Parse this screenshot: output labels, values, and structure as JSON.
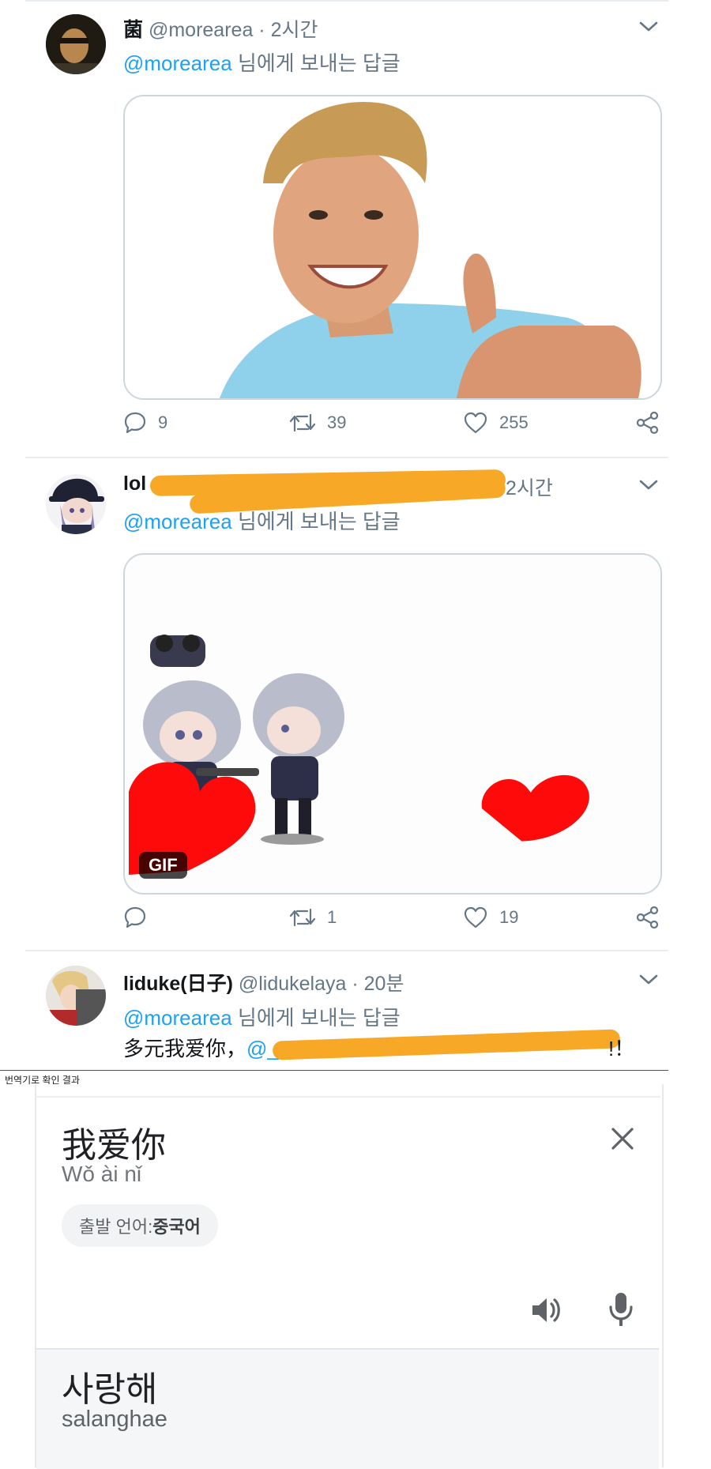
{
  "tweets": [
    {
      "name": "菌",
      "handle": "@morearea",
      "dot": "·",
      "time": "2시간",
      "reply_mention": "@morearea",
      "reply_suffix": " 님에게 보내는 답글",
      "replies": "9",
      "retweets": "39",
      "likes": "255"
    },
    {
      "name": "lol",
      "time": "2시간",
      "reply_mention": "@morearea",
      "reply_suffix": " 님에게 보내는 답글",
      "gif_label": "GIF",
      "replies": "",
      "retweets": "1",
      "likes": "19"
    },
    {
      "name": "liduke(日子)",
      "handle": "@lidukelaya",
      "dot": "·",
      "time": "20분",
      "reply_mention": "@morearea",
      "reply_suffix": " 님에게 보내는 답글",
      "body_start": "多元我爱你，",
      "body_mention": "@_Cl",
      "body_end": "!！"
    }
  ],
  "translate": {
    "caption": "번역기로 확인 결과",
    "source_text": "我爱你",
    "source_pinyin": "Wǒ ài nǐ",
    "source_lang_prefix": "출발 언어: ",
    "source_lang": "중국어",
    "result_text": "사랑해",
    "result_romanization": "salanghae"
  },
  "icons": [
    "reply-icon",
    "retweet-icon",
    "like-icon",
    "share-icon",
    "chevron-down-icon",
    "close-icon",
    "speaker-icon",
    "mic-icon"
  ],
  "colors": {
    "link": "#1da1f2",
    "muted": "#657786",
    "redaction": "#f7a826",
    "heart": "#ff0a0a"
  }
}
